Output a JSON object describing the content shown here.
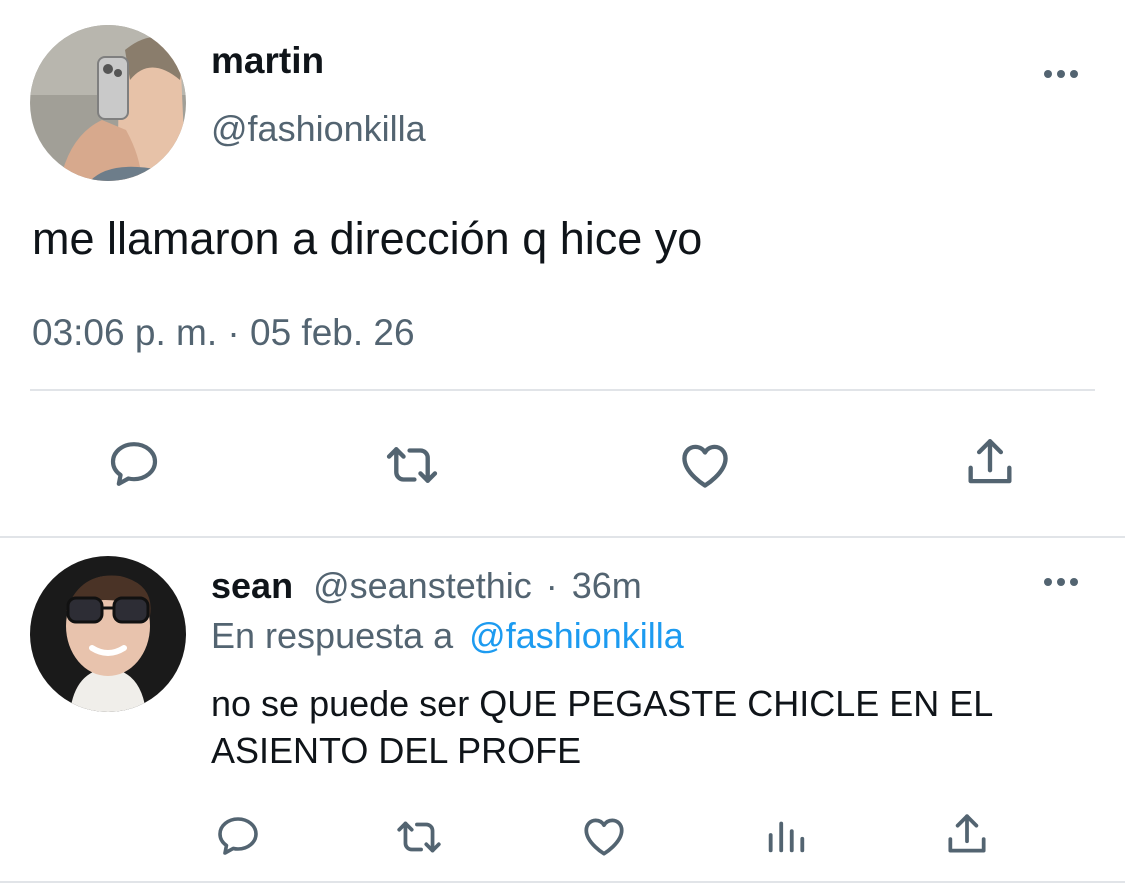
{
  "main_tweet": {
    "display_name": "martin",
    "handle": "@fashionkilla",
    "text": "me llamaron a dirección q hice yo",
    "timestamp": "03:06 p. m. · 05 feb. 26",
    "avatar_icon": "selfie-avatar",
    "actions": [
      "reply-icon",
      "retweet-icon",
      "like-icon",
      "share-icon"
    ]
  },
  "reply_tweet": {
    "display_name": "sean",
    "handle": "@seanstethic",
    "separator": "·",
    "time": "36m",
    "reply_prefix": "En respuesta a",
    "reply_to": "@fashionkilla",
    "text": "no se puede ser QUE PEGASTE CHICLE EN EL ASIENTO DEL PROFE",
    "avatar_icon": "person-with-glasses-avatar",
    "actions": [
      "reply-icon",
      "retweet-icon",
      "like-icon",
      "analytics-icon",
      "share-icon"
    ]
  },
  "colors": {
    "text": "#0f1419",
    "muted": "#536471",
    "link": "#1d9bf0",
    "divider": "#e1e4e8"
  }
}
